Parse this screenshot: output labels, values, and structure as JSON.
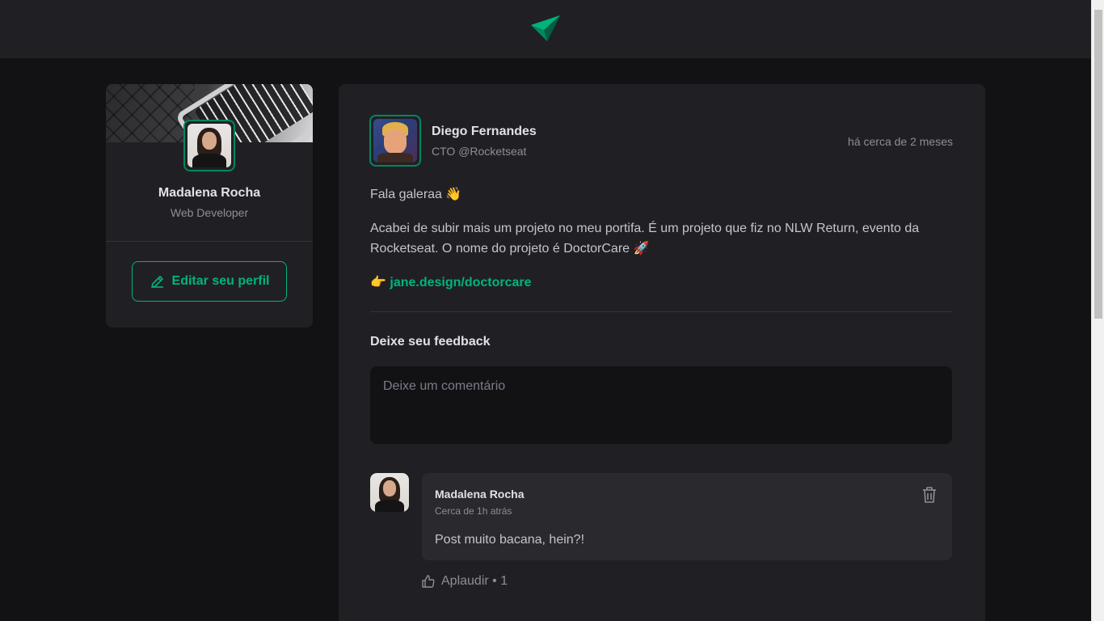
{
  "header": {
    "logo": "paper-plane-logo"
  },
  "profile": {
    "name": "Madalena Rocha",
    "role": "Web Developer",
    "edit_label": "Editar seu perfil",
    "edit_icon": "pencil-icon"
  },
  "post": {
    "author": {
      "name": "Diego Fernandes",
      "role": "CTO @Rocketseat"
    },
    "time": "há cerca de 2 meses",
    "greeting": "Fala galeraa 👋",
    "body": "Acabei de subir mais um projeto no meu portifa. É um projeto que fiz no NLW Return, evento da Rocketseat. O nome do projeto é DoctorCare 🚀",
    "link_emoji": "👉",
    "link": "jane.design/doctorcare",
    "feedback_title": "Deixe seu feedback",
    "comment_placeholder": "Deixe um comentário"
  },
  "comment": {
    "author": "Madalena Rocha",
    "time": "Cerca de 1h atrás",
    "text": "Post muito bacana, hein?!",
    "applaud_label": "Aplaudir • 1",
    "trash_icon": "trash-icon",
    "like_icon": "thumbs-up-icon"
  },
  "colors": {
    "background": "#121214",
    "card": "#202024",
    "accent": "#00b37e",
    "accent_dark": "#00875f"
  }
}
